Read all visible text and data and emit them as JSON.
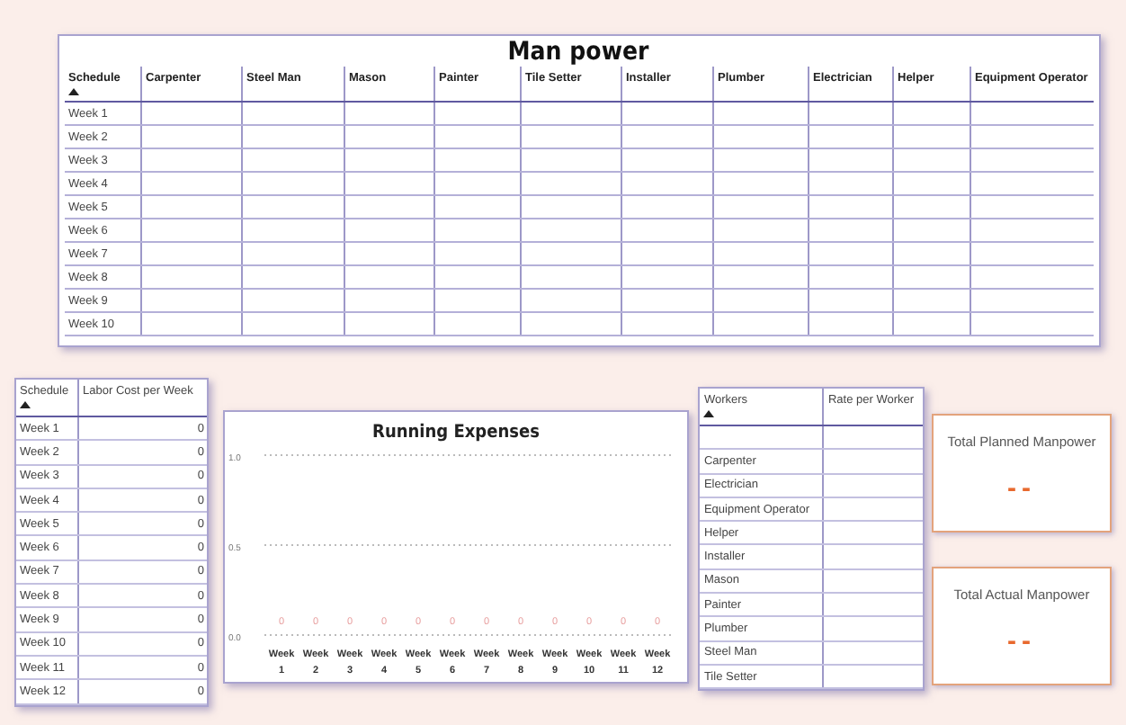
{
  "manpower": {
    "title": "Man power",
    "columns": [
      "Schedule",
      "Carpenter",
      "Steel Man",
      "Mason",
      "Painter",
      "Tile Setter",
      "Installer",
      "Plumber",
      "Electrician",
      "Helper",
      "Equipment Operator"
    ],
    "rows": [
      "Week 1",
      "Week 2",
      "Week 3",
      "Week 4",
      "Week 5",
      "Week 6",
      "Week 7",
      "Week 8",
      "Week 9",
      "Week 10"
    ]
  },
  "labor_cost": {
    "columns": [
      "Schedule",
      "Labor Cost per Week"
    ],
    "rows": [
      [
        "Week 1",
        "0"
      ],
      [
        "Week 2",
        "0"
      ],
      [
        "Week 3",
        "0"
      ],
      [
        "Week 4",
        "0"
      ],
      [
        "Week 5",
        "0"
      ],
      [
        "Week 6",
        "0"
      ],
      [
        "Week 7",
        "0"
      ],
      [
        "Week 8",
        "0"
      ],
      [
        "Week 9",
        "0"
      ],
      [
        "Week 10",
        "0"
      ],
      [
        "Week 11",
        "0"
      ],
      [
        "Week 12",
        "0"
      ]
    ]
  },
  "running_expenses": {
    "chart_data": {
      "type": "bar",
      "title": "Running Expenses",
      "categories": [
        "Week 1",
        "Week 2",
        "Week 3",
        "Week 4",
        "Week 5",
        "Week 6",
        "Week 7",
        "Week 8",
        "Week 9",
        "Week 10",
        "Week 11",
        "Week 12"
      ],
      "values": [
        0,
        0,
        0,
        0,
        0,
        0,
        0,
        0,
        0,
        0,
        0,
        0
      ],
      "ylim": [
        0,
        1
      ],
      "yticks": [
        {
          "value": 0,
          "label": "0.0"
        },
        {
          "value": 0.5,
          "label": "0.5"
        },
        {
          "value": 1,
          "label": "1.0"
        }
      ],
      "data_labels": true
    }
  },
  "workers": {
    "columns": [
      "Workers",
      "Rate per Worker"
    ],
    "rows": [
      "",
      "Carpenter",
      "Electrician",
      "Equipment Operator",
      "Helper",
      "Installer",
      "Mason",
      "Painter",
      "Plumber",
      "Steel Man",
      "Tile Setter"
    ]
  },
  "cards": [
    {
      "title": "Total Planned Manpower",
      "value": "--"
    },
    {
      "title": "Total Actual Manpower",
      "value": "--"
    }
  ]
}
